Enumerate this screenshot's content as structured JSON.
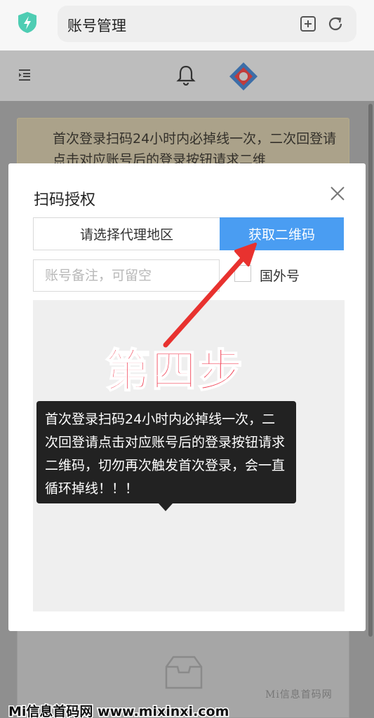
{
  "browser": {
    "page_title": "账号管理",
    "icons": [
      "shield-bolt-icon",
      "add-bookmark-icon",
      "refresh-icon"
    ]
  },
  "app_header": {
    "icons": [
      "menu-collapse-icon",
      "bell-icon",
      "app-logo-icon"
    ]
  },
  "notice": {
    "text": "首次登录扫码24小时内必掉线一次，二次回登请点击对应账号后的登录按钮请求二维"
  },
  "modal": {
    "title": "扫码授权",
    "region_select_label": "请选择代理地区",
    "get_qr_button": "获取二维码",
    "remark_placeholder": "账号备注，可留空",
    "overseas_checkbox_label": "国外号"
  },
  "annotation": {
    "step_label": "第四步"
  },
  "tooltip": {
    "text": "首次登录扫码24小时内必掉线一次，二次回登请点击对应账号后的登录按钮请求二维码，切勿再次触发首次登录，会一直循环掉线！！！"
  },
  "watermark": {
    "small": "Mi信息首码网",
    "big": "Mi信息首码网 www.mixinxi.com"
  },
  "colors": {
    "primary": "#4a9df2",
    "annotation_red": "#f03a4f",
    "tooltip_bg": "#222222"
  }
}
